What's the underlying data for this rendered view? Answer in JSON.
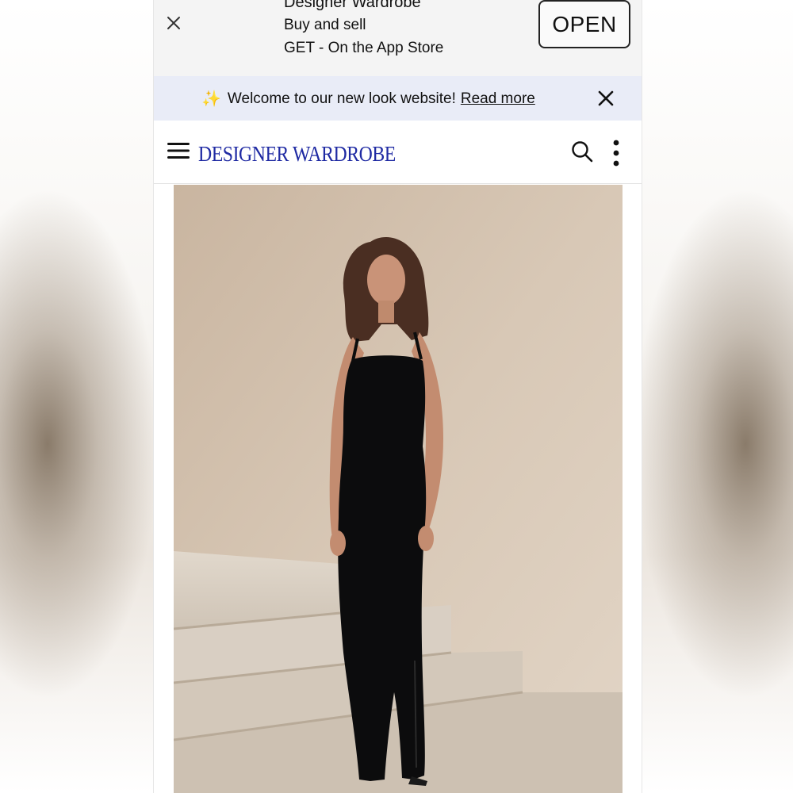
{
  "app_banner": {
    "app_name": "Designer Wardrobe",
    "tagline": "Buy and sell",
    "store_text": "GET - On the App Store",
    "open_label": "OPEN",
    "close_icon": "close-icon"
  },
  "announcement": {
    "sparkle_icon": "✨",
    "message": "Welcome to our new look website!",
    "link_label": "Read more",
    "close_icon": "close-icon"
  },
  "header": {
    "logo_text": "DESIGNER WARDROBE",
    "menu_icon": "hamburger-menu-icon",
    "search_icon": "search-icon",
    "more_icon": "more-vertical-icon",
    "logo_color": "#1f2aa3"
  },
  "product": {
    "image_subject": "photo"
  }
}
